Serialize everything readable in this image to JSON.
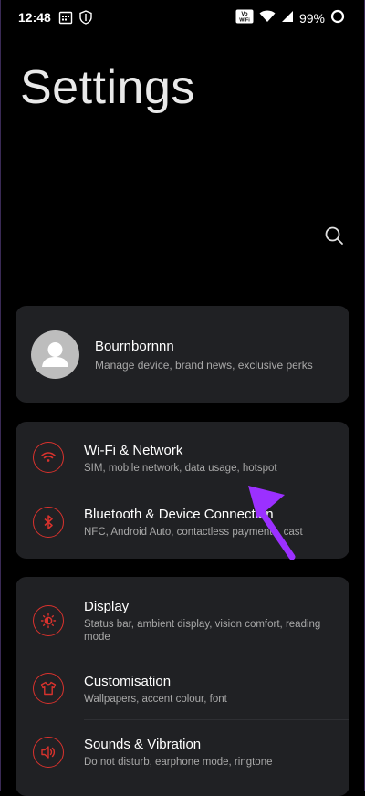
{
  "status_bar": {
    "time": "12:48",
    "battery": "99%",
    "volte_label": "Vo WiFi"
  },
  "page": {
    "title": "Settings"
  },
  "profile": {
    "name": "Bournbornnn",
    "subtitle": "Manage device, brand news, exclusive perks"
  },
  "network_group": [
    {
      "title": "Wi-Fi & Network",
      "subtitle": "SIM, mobile network, data usage, hotspot",
      "icon": "wifi-icon"
    },
    {
      "title": "Bluetooth & Device Connection",
      "subtitle": "NFC, Android Auto, contactless payments, cast",
      "icon": "bluetooth-icon"
    }
  ],
  "display_group": [
    {
      "title": "Display",
      "subtitle": "Status bar, ambient display, vision comfort, reading mode",
      "icon": "brightness-icon"
    },
    {
      "title": "Customisation",
      "subtitle": "Wallpapers, accent colour, font",
      "icon": "tshirt-icon"
    },
    {
      "title": "Sounds & Vibration",
      "subtitle": "Do not disturb, earphone mode, ringtone",
      "icon": "speaker-icon"
    }
  ],
  "colors": {
    "background": "#000000",
    "card": "#202124",
    "accent_red": "#d8322d",
    "annotation_arrow": "#9b30ff"
  }
}
